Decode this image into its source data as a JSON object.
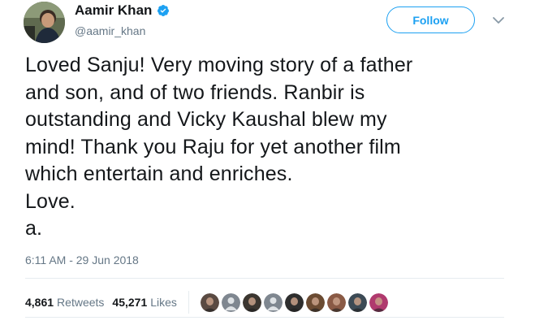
{
  "author": {
    "display_name": "Aamir Khan",
    "handle": "@aamir_khan",
    "verified": true,
    "avatar_icon": "profile-avatar"
  },
  "follow_button": {
    "label": "Follow",
    "accent_color": "#1da1f2"
  },
  "menu_icon": "chevron-down-icon",
  "tweet": {
    "lines": [
      "Loved Sanju! Very moving story of a father",
      "and son, and of two friends. Ranbir is",
      "outstanding and Vicky Kaushal blew my",
      "mind! Thank you Raju for yet another film",
      "which entertain and enriches.",
      "Love.",
      "a."
    ],
    "timestamp": "6:11 AM - 29 Jun 2018"
  },
  "stats": {
    "retweets_count": "4,861",
    "retweets_label": "Retweets",
    "likes_count": "45,271",
    "likes_label": "Likes"
  },
  "likers": [
    {
      "icon": "user-avatar-icon",
      "color": "#5a4a42"
    },
    {
      "icon": "default-avatar-icon",
      "color": "#7f8790"
    },
    {
      "icon": "user-avatar-icon",
      "color": "#3b3630"
    },
    {
      "icon": "default-avatar-icon",
      "color": "#7f8790"
    },
    {
      "icon": "user-avatar-icon",
      "color": "#2e2e2e"
    },
    {
      "icon": "user-avatar-icon",
      "color": "#6b4b32"
    },
    {
      "icon": "user-avatar-icon",
      "color": "#8a5a45"
    },
    {
      "icon": "user-avatar-icon",
      "color": "#3c4a55"
    },
    {
      "icon": "user-avatar-icon",
      "color": "#b03a6e"
    }
  ]
}
